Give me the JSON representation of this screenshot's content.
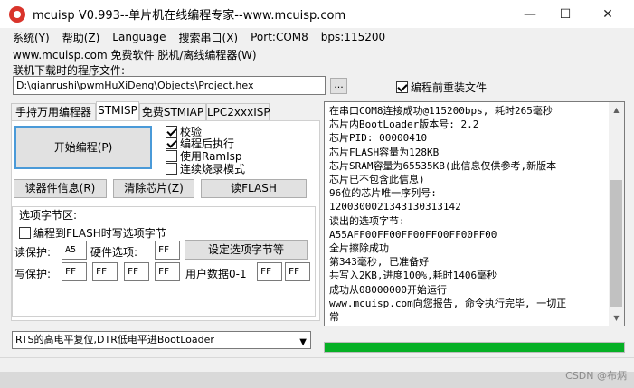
{
  "window": {
    "title": "mcuisp V0.993--单片机在线编程专家--www.mcuisp.com",
    "min_glyph": "—",
    "max_glyph": "☐",
    "close_glyph": "✕"
  },
  "menu": [
    "系统(Y)",
    "帮助(Z)",
    "Language",
    "搜索串口(X)",
    "Port:COM8",
    "bps:115200"
  ],
  "site_text": "www.mcuisp.com 免费软件 脱机/离线编程器(W)",
  "file": {
    "label": "联机下载时的程序文件:",
    "path": "D:\\qianrushi\\pwmHuXiDeng\\Objects\\Project.hex",
    "browse": "...",
    "reload_label": "编程前重装文件",
    "reload_checked": true
  },
  "tabs": [
    "手持万用编程器",
    "STMISP",
    "免费STMIAP",
    "LPC2xxxISP"
  ],
  "active_tab": 1,
  "buttons": {
    "start": "开始编程(P)",
    "read_info": "读器件信息(R)",
    "erase": "清除芯片(Z)",
    "read_flash": "读FLASH",
    "set_option": "设定选项字节等"
  },
  "options": [
    {
      "label": "校验",
      "checked": true
    },
    {
      "label": "编程后执行",
      "checked": true
    },
    {
      "label": "使用RamIsp",
      "checked": false
    },
    {
      "label": "连续烧录模式",
      "checked": false
    }
  ],
  "option_bytes": {
    "title": "选项字节区:",
    "write_flash_label": "编程到FLASH时写选项字节",
    "write_flash_checked": false,
    "read_protect_label": "读保护:",
    "read_protect": "A5",
    "hw_option_label": "硬件选项:",
    "hw_option": "FF",
    "write_protect_label": "写保护:",
    "write_protect": [
      "FF",
      "FF",
      "FF",
      "FF"
    ],
    "user_data_label": "用户数据0-1",
    "user_data": [
      "FF",
      "FF"
    ]
  },
  "reset_mode": "RTS的高电平复位,DTR低电平进BootLoader",
  "log": [
    "在串口COM8连接成功@115200bps, 耗时265毫秒",
    "芯片内BootLoader版本号: 2.2",
    "芯片PID: 00000410",
    "芯片FLASH容量为128KB",
    "芯片SRAM容量为65535KB(此信息仅供参考,新版本",
    "芯片已不包含此信息)",
    "96位的芯片唯一序列号:",
    "1200300021343130313142",
    "读出的选项字节:",
    "A55AFF00FF00FF00FF00FF00FF00",
    "全片擦除成功",
    "第343毫秒, 已准备好",
    "共写入2KB,进度100%,耗时1406毫秒",
    "成功从08000000开始运行",
    "www.mcuisp.com向您报告, 命令执行完毕, 一切正",
    "常"
  ],
  "progress_percent": 100,
  "watermark": "CSDN @布炳"
}
